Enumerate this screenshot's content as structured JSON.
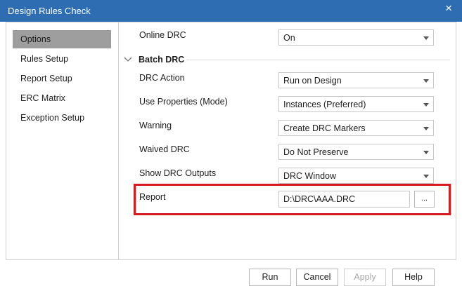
{
  "window": {
    "title": "Design Rules Check",
    "close_glyph": "×"
  },
  "sidebar": {
    "items": [
      {
        "label": "Options",
        "active": true
      },
      {
        "label": "Rules Setup"
      },
      {
        "label": "Report Setup"
      },
      {
        "label": "ERC Matrix"
      },
      {
        "label": "Exception Setup"
      }
    ]
  },
  "options": {
    "online_drc": {
      "label": "Online DRC",
      "value": "On"
    },
    "batch_section": {
      "label": "Batch DRC",
      "icon": "chevron-down-icon"
    },
    "drc_action": {
      "label": "DRC Action",
      "value": "Run on Design"
    },
    "use_properties": {
      "label": "Use Properties (Mode)",
      "value": "Instances (Preferred)"
    },
    "warning": {
      "label": "Warning",
      "value": "Create DRC Markers"
    },
    "waived_drc": {
      "label": "Waived DRC",
      "value": "Do Not Preserve"
    },
    "show_outputs": {
      "label": "Show DRC Outputs",
      "value": "DRC Window"
    },
    "report": {
      "label": "Report",
      "value": "D:\\DRC\\AAA.DRC",
      "browse_label": "..."
    }
  },
  "footer": {
    "run": "Run",
    "cancel": "Cancel",
    "apply": "Apply",
    "help": "Help"
  },
  "colors": {
    "titlebar": "#2f6db3",
    "active_nav": "#9e9e9e",
    "highlight": "#d71920"
  }
}
